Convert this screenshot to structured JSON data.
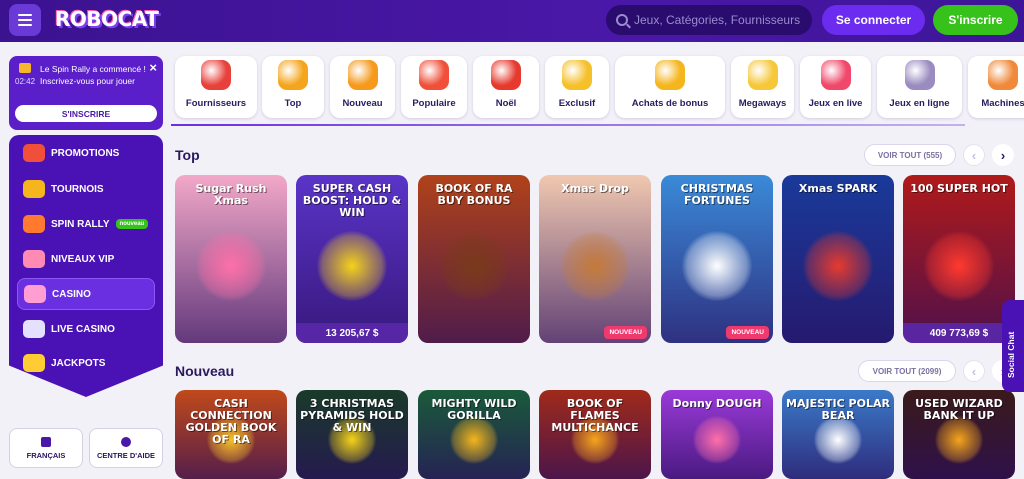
{
  "header": {
    "logo": "ROBOCAT",
    "search_placeholder": "Jeux, Catégories, Fournisseurs",
    "login_label": "Se connecter",
    "signup_label": "S'inscrire"
  },
  "rally_notice": {
    "time": "02:42",
    "message": "Le Spin Rally a commencé ! Inscrivez-vous pour jouer",
    "cta_label": "S'INSCRIRE",
    "close_icon": "×"
  },
  "sidebar": {
    "items": [
      {
        "label": "PROMOTIONS",
        "icon": "gift-icon",
        "color": "#f0503a"
      },
      {
        "label": "TOURNOIS",
        "icon": "trophy-icon",
        "color": "#f5b51d"
      },
      {
        "label": "SPIN RALLY",
        "icon": "rally-icon",
        "color": "#ff7a2e",
        "badge": "nouveau"
      },
      {
        "label": "NIVEAUX VIP",
        "icon": "vip-icon",
        "color": "#ff8ab4"
      },
      {
        "label": "CASINO",
        "icon": "casino-icon",
        "color": "#ff9ed3",
        "active": true
      },
      {
        "label": "LIVE CASINO",
        "icon": "live-icon",
        "color": "#e6e0ff"
      },
      {
        "label": "JACKPOTS",
        "icon": "jackpot-icon",
        "color": "#ffcc33"
      }
    ],
    "language_label": "FRANÇAIS",
    "help_label": "CENTRE D'AIDE"
  },
  "categories": [
    {
      "label": "Fournisseurs",
      "color": "#e8413c"
    },
    {
      "label": "Top",
      "color": "#f5a51d"
    },
    {
      "label": "Nouveau",
      "color": "#f59a1d"
    },
    {
      "label": "Populaire",
      "color": "#f0503a"
    },
    {
      "label": "Noël",
      "color": "#e63a2e"
    },
    {
      "label": "Exclusif",
      "color": "#f5c02a"
    },
    {
      "label": "Achats de bonus",
      "color": "#f5b51d"
    },
    {
      "label": "Megaways",
      "color": "#f5c83a"
    },
    {
      "label": "Jeux en live",
      "color": "#f0486a"
    },
    {
      "label": "Jeux en ligne",
      "color": "#9a8cc0"
    },
    {
      "label": "Machines",
      "color": "#f08a3a"
    }
  ],
  "sections": [
    {
      "title": "Top",
      "view_all": "VOIR TOUT (555)",
      "games": [
        {
          "title": "Sugar Rush Xmas",
          "bg": "#f2a8c8",
          "accent": "#ff6fa8"
        },
        {
          "title": "SUPER CASH BOOST: HOLD & WIN",
          "bg": "#5a34c8",
          "accent": "#f5d21a",
          "jackpot": "13 205,67 $"
        },
        {
          "title": "BOOK OF RA BUY BONUS",
          "bg": "#b0421a",
          "accent": "#7a3a1a"
        },
        {
          "title": "Xmas Drop",
          "bg": "#f0c8b0",
          "accent": "#c47a3a",
          "badge": "NOUVEAU"
        },
        {
          "title": "CHRISTMAS FORTUNES",
          "bg": "#3a8ad8",
          "accent": "#ffffff",
          "badge": "NOUVEAU"
        },
        {
          "title": "Xmas SPARK",
          "bg": "#1a3a9a",
          "accent": "#e63a2e"
        },
        {
          "title": "100 SUPER HOT",
          "bg": "#b01a1a",
          "accent": "#ff3a2e",
          "jackpot": "409 773,69 $"
        }
      ]
    },
    {
      "title": "Nouveau",
      "view_all": "VOIR TOUT (2099)",
      "games": [
        {
          "title": "CASH CONNECTION GOLDEN BOOK OF RA",
          "bg": "#c0491a",
          "accent": "#f5c02a"
        },
        {
          "title": "3 CHRISTMAS PYRAMIDS HOLD & WIN",
          "bg": "#1a3a2a",
          "accent": "#f5d21a"
        },
        {
          "title": "MIGHTY WILD GORILLA",
          "bg": "#1a5a3a",
          "accent": "#f5b51d"
        },
        {
          "title": "BOOK OF FLAMES MULTICHANCE",
          "bg": "#a02a1a",
          "accent": "#f5a51d"
        },
        {
          "title": "Donny DOUGH",
          "bg": "#9a3ad8",
          "accent": "#ff6fa8"
        },
        {
          "title": "MAJESTIC POLAR BEAR",
          "bg": "#3a7ac8",
          "accent": "#ffffff"
        },
        {
          "title": "USED WIZARD BANK IT UP",
          "bg": "#3a1a1a",
          "accent": "#f5a51d"
        }
      ]
    }
  ],
  "social_chat": "Social Chat"
}
